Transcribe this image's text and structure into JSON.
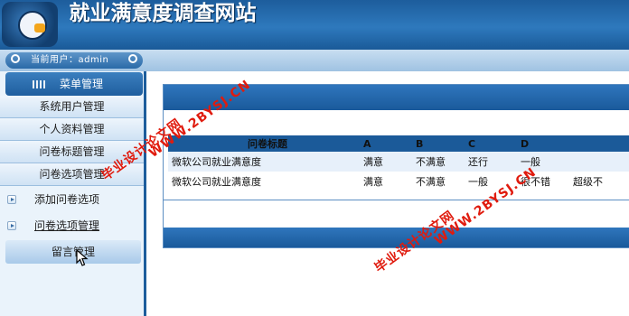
{
  "header": {
    "title": "就业满意度调查网站"
  },
  "userbar": {
    "current_user_label": "当前用户：admin"
  },
  "sidebar": {
    "menu_title": "菜单管理",
    "items": [
      {
        "label": "系统用户管理"
      },
      {
        "label": "个人资料管理"
      },
      {
        "label": "问卷标题管理"
      },
      {
        "label": "问卷选项管理"
      }
    ],
    "subitems": [
      {
        "label": "添加问卷选项"
      },
      {
        "label": "问卷选项管理"
      }
    ],
    "message_button": "留言管理"
  },
  "table": {
    "headers": [
      "问卷标题",
      "A",
      "B",
      "C",
      "D",
      ""
    ],
    "rows": [
      [
        "微软公司就业满意度",
        "满意",
        "不满意",
        "还行",
        "一般",
        ""
      ],
      [
        "微软公司就业满意度",
        "满意",
        "不满意",
        "一般",
        "很不错",
        "超级不"
      ]
    ]
  },
  "watermarks": [
    "毕业设计论文网",
    "WWW.2BYSJ.CN"
  ],
  "colors": {
    "header_blue": "#1d5d9c",
    "watermark_red": "#e01b0e",
    "logo_orange": "#f3a51b"
  }
}
